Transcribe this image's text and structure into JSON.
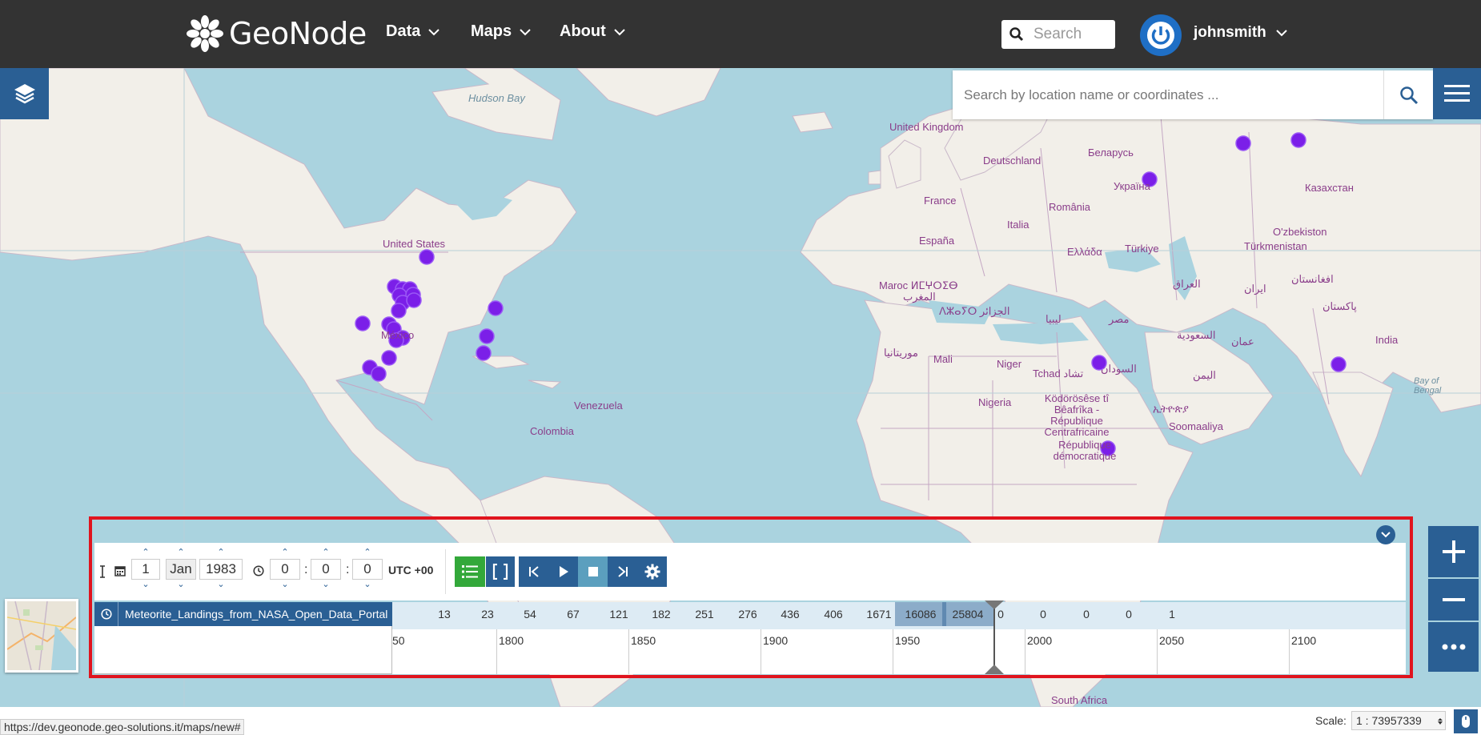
{
  "navbar": {
    "brand": "GeoNode",
    "menus": [
      "Data",
      "Maps",
      "About"
    ],
    "search_placeholder": "Search",
    "user": "johnsmith"
  },
  "map": {
    "location_search_placeholder": "Search by location name or coordinates ...",
    "labels": {
      "hudson_bay": "Hudson Bay",
      "united_states": "United States",
      "mexico": "México",
      "venezuela": "Venezuela",
      "colombia": "Colombia",
      "united_kingdom": "United Kingdom",
      "deutschland": "Deutschland",
      "france": "France",
      "espana": "España",
      "italia": "Italia",
      "romania": "România",
      "ukraine": "Україна",
      "belarus": "Беларусь",
      "kazakhstan": "Казахстан",
      "uzbekistan": "O'zbekiston",
      "turkmenistan": "Türkmenistan",
      "turkiye": "Türkiye",
      "ellada": "Ελλάδα",
      "iraq": "العراق",
      "iran": "ایران",
      "afghanistan": "افغانستان",
      "pakistan": "پاکستان",
      "india": "India",
      "bay_of_bengal": "Bay of Bengal",
      "maroc": "Maroc ⵍⵎⵖⵔⵉⴱ",
      "maghreb": "المغرب",
      "algerie": "ⴷⵣⴰⵢⵔ الجزائر",
      "libya": "ليبيا",
      "egypt": "مصر",
      "saudi": "السعودية",
      "oman": "عمان",
      "yemen": "اليمن",
      "mauritania": "موريتانيا",
      "mali": "Mali",
      "niger": "Niger",
      "tchad": "Tchad تشاد",
      "sudan": "السودان",
      "ethiopia": "ኢትዮጵያ",
      "nigeria": "Nigeria",
      "car": "Ködörösêse tî Bêafrîka - République Centrafricaine",
      "somaliland": "Soomaaliya",
      "drc": "République démocratique",
      "south_africa": "South Africa"
    }
  },
  "timeline": {
    "date": {
      "day": "1",
      "month": "Jan",
      "year": "1983"
    },
    "time": {
      "hours": "0",
      "minutes": "0",
      "seconds": "0"
    },
    "timezone": "UTC +00",
    "layer_name": "Meteorite_Landings_from_NASA_Open_Data_Portal",
    "histogram": {
      "counts": [
        "13",
        "23",
        "54",
        "67",
        "121",
        "182",
        "251",
        "276",
        "436",
        "406",
        "1671",
        "16086",
        "25804",
        "0",
        "0",
        "0",
        "0",
        "1"
      ],
      "highlighted": [
        11,
        12
      ]
    },
    "axis_labels": [
      "50",
      "1800",
      "1850",
      "1900",
      "1950",
      "2000",
      "2050",
      "2100"
    ]
  },
  "statusbar": {
    "url": "https://dev.geonode.geo-solutions.it/maps/new#",
    "scale_label": "Scale:",
    "scale_value": "1 : 73957339"
  }
}
